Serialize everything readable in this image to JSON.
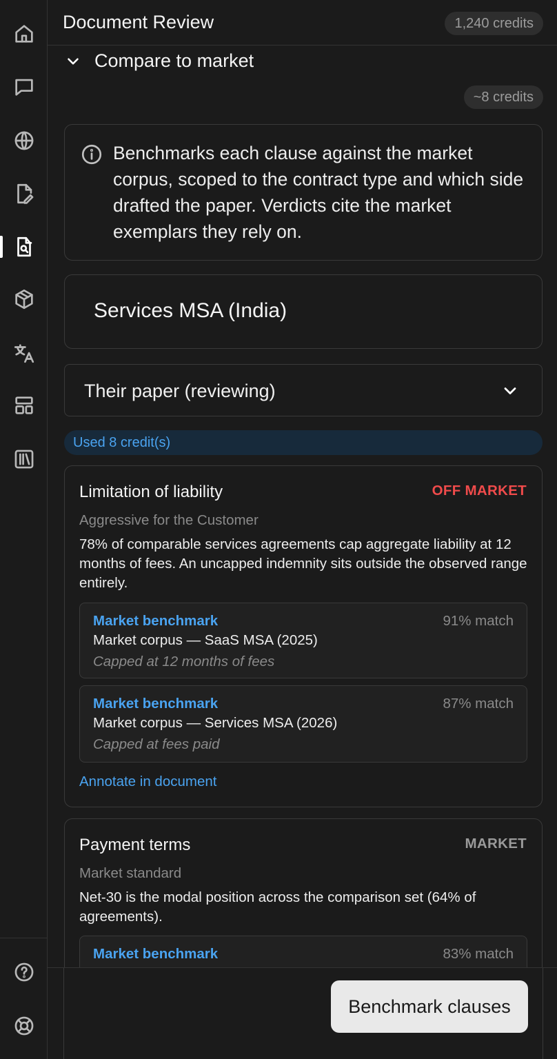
{
  "header": {
    "title": "Document Review",
    "credits": "1,240 credits"
  },
  "rail": {
    "items": [
      {
        "icon": "home-icon"
      },
      {
        "icon": "chat-icon"
      },
      {
        "icon": "globe-icon"
      },
      {
        "icon": "file-edit-icon"
      },
      {
        "icon": "file-search-icon",
        "active": true
      },
      {
        "icon": "cube-icon"
      },
      {
        "icon": "translate-icon"
      },
      {
        "icon": "layout-icon"
      },
      {
        "icon": "library-icon"
      },
      {
        "icon": "help-icon"
      },
      {
        "icon": "lifebuoy-icon"
      }
    ]
  },
  "section": {
    "title": "Compare to market",
    "cost": "~8 credits",
    "info": "Benchmarks each clause against the market corpus, scoped to the contract type and which side drafted the paper. Verdicts cite the market exemplars they rely on.",
    "contract_type": "Services MSA (India)",
    "side": "Their paper (reviewing)",
    "used": "Used 8 credit(s)"
  },
  "colors": {
    "accent": "#4aa3f0",
    "off_market": "#f04b4b",
    "market": "#9a9a9a",
    "button_bg": "#e9e9e9"
  },
  "clauses": [
    {
      "title": "Limitation of liability",
      "verdict": "OFF MARKET",
      "subtitle": "Aggressive for the Customer",
      "body": "78% of comparable services agreements cap aggregate liability at 12 months of fees. An uncapped indemnity sits outside the observed range entirely.",
      "benchmarks": [
        {
          "label": "Market benchmark",
          "match": "91% match",
          "source": "Market corpus — SaaS MSA (2025)",
          "quote": "Capped at 12 months of fees"
        },
        {
          "label": "Market benchmark",
          "match": "87% match",
          "source": "Market corpus — Services MSA (2026)",
          "quote": "Capped at fees paid"
        }
      ],
      "link": "Annotate in document"
    },
    {
      "title": "Payment terms",
      "verdict": "MARKET",
      "subtitle": "Market standard",
      "body": "Net-30 is the modal position across the comparison set (64% of agreements).",
      "benchmarks": [
        {
          "label": "Market benchmark",
          "match": "83% match"
        }
      ]
    }
  ],
  "action": {
    "label": "Benchmark clauses"
  }
}
